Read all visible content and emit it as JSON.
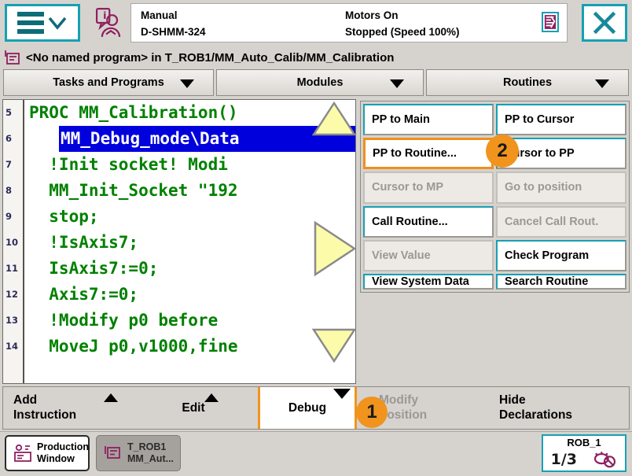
{
  "header": {
    "menu_icon": "hamburger-menu-icon",
    "info_icon": "operator-info-icon",
    "mode": "Manual",
    "controller": "D-SHMM-324",
    "motors": "Motors On",
    "execution": "Stopped (Speed 100%)",
    "program_state_icon": "program-stopped-icon",
    "close_icon": "close-icon",
    "accent": "#17a0b4"
  },
  "breadcrumb": {
    "icon": "program-file-icon",
    "text": "<No named program> in T_ROB1/MM_Auto_Calib/MM_Calibration"
  },
  "tabs": [
    {
      "label": "Tasks and Programs"
    },
    {
      "label": "Modules"
    },
    {
      "label": "Routines"
    }
  ],
  "editor": {
    "lines": [
      {
        "num": "5",
        "text": "PROC MM_Calibration()",
        "selected": false
      },
      {
        "num": "6",
        "text": "MM_Debug_mode\\Data",
        "selected": true
      },
      {
        "num": "7",
        "text": "  !Init socket! Modi",
        "selected": false
      },
      {
        "num": "8",
        "text": "  MM_Init_Socket \"192",
        "selected": false
      },
      {
        "num": "9",
        "text": "  stop;",
        "selected": false
      },
      {
        "num": "10",
        "text": "  !IsAxis7;",
        "selected": false
      },
      {
        "num": "11",
        "text": "  IsAxis7:=0;",
        "selected": false
      },
      {
        "num": "12",
        "text": "  Axis7:=0;",
        "selected": false
      },
      {
        "num": "13",
        "text": "  !Modify p0 before ",
        "selected": false
      },
      {
        "num": "14",
        "text": "  MoveJ p0,v1000,fine",
        "selected": false
      }
    ],
    "scroll_arrows": [
      "scroll-up-arrow",
      "scroll-right-arrow",
      "scroll-down-arrow"
    ],
    "code_color": "#008000",
    "selection_color": "#0000dd"
  },
  "popup_menu": {
    "items": [
      {
        "label": "PP to Main",
        "state": "enabled"
      },
      {
        "label": "PP to Cursor",
        "state": "enabled"
      },
      {
        "label": "PP to Routine...",
        "state": "highlight"
      },
      {
        "label": "Cursor to PP",
        "state": "enabled"
      },
      {
        "label": "Cursor to MP",
        "state": "disabled"
      },
      {
        "label": "Go to position",
        "state": "disabled"
      },
      {
        "label": "Call Routine...",
        "state": "enabled"
      },
      {
        "label": "Cancel Call Rout.",
        "state": "disabled"
      },
      {
        "label": "View Value",
        "state": "disabled"
      },
      {
        "label": "Check Program",
        "state": "enabled"
      },
      {
        "label": "View System Data",
        "state": "enabled"
      },
      {
        "label": "Search Routine",
        "state": "enabled"
      }
    ],
    "highlight_color": "#f08f1c"
  },
  "badges": [
    {
      "id": "step-1",
      "label": "1"
    },
    {
      "id": "step-2",
      "label": "2"
    }
  ],
  "bottom_toolbar": {
    "add_instruction_l1": "Add",
    "add_instruction_l2": "Instruction",
    "edit": "Edit",
    "debug": "Debug",
    "modify_position_l1": "Modify",
    "modify_position_l2": "Position",
    "hide_declarations_l1": "Hide",
    "hide_declarations_l2": "Declarations"
  },
  "taskbar": {
    "window1_l1": "Production",
    "window1_l2": "Window",
    "window1_icon": "production-window-icon",
    "window2_l1": "T_ROB1",
    "window2_l2": "MM_Aut...",
    "window2_icon": "program-editor-icon",
    "rob_title": "ROB_1",
    "rob_fraction": "1/3",
    "rob_icon": "motors-off-icon"
  }
}
